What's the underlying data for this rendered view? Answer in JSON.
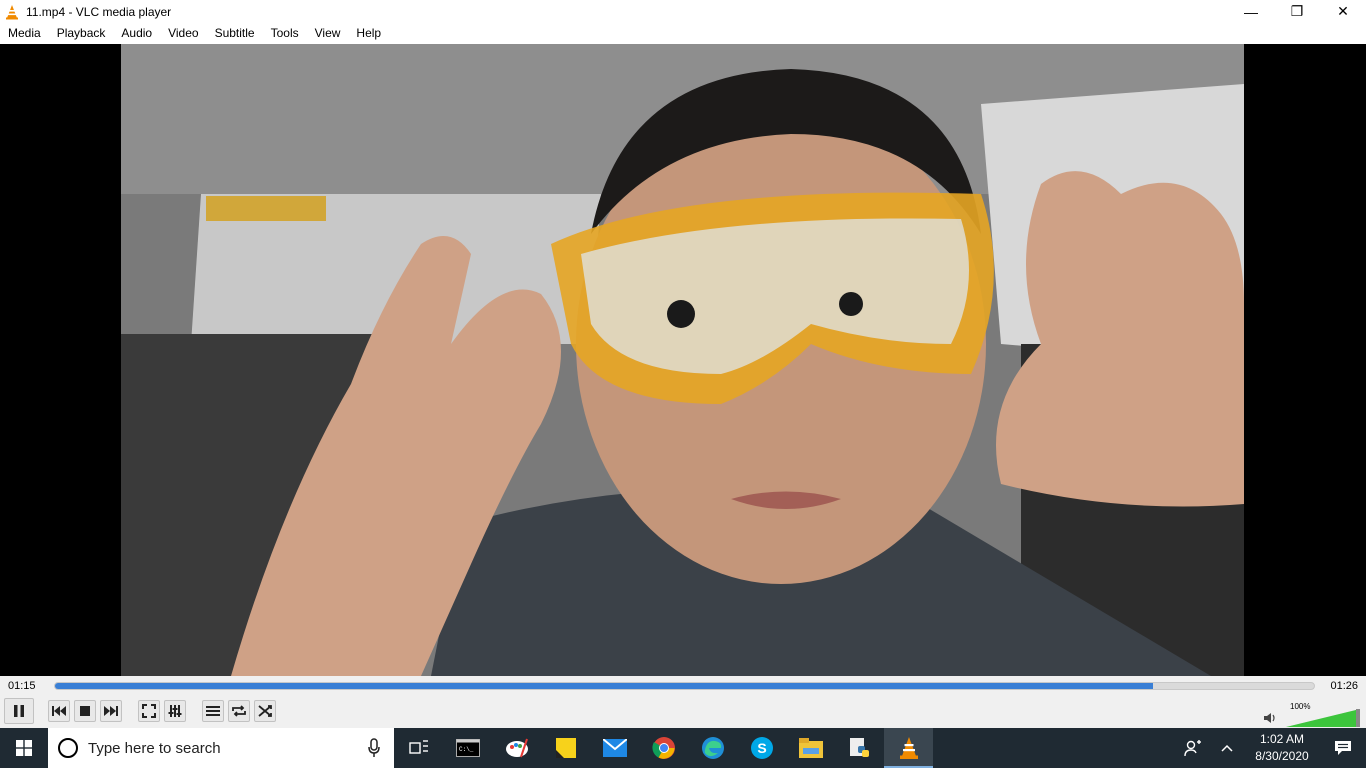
{
  "window": {
    "title": "11.mp4 - VLC media player",
    "minimize_label": "—",
    "restore_label": "❐",
    "close_label": "✕"
  },
  "menu": [
    "Media",
    "Playback",
    "Audio",
    "Video",
    "Subtitle",
    "Tools",
    "View",
    "Help"
  ],
  "player": {
    "elapsed": "01:15",
    "total": "01:26",
    "progress_fraction": 0.872,
    "volume_label": "100%",
    "volume_fraction": 1.0,
    "video_description_icon": "video-frame"
  },
  "taskbar": {
    "search_placeholder": "Type here to search",
    "time": "1:02 AM",
    "date": "8/30/2020",
    "pinned": [
      "task-view-icon",
      "terminal-icon",
      "paint-icon",
      "sticky-notes-icon",
      "mail-icon",
      "chrome-icon",
      "edge-icon",
      "skype-icon",
      "file-explorer-icon",
      "python-icon",
      "vlc-icon"
    ]
  },
  "colors": {
    "accent": "#3a7fd5",
    "vlc_orange": "#f08a00",
    "volume_green": "#3cc53c",
    "taskbar": "#1f2a33"
  }
}
